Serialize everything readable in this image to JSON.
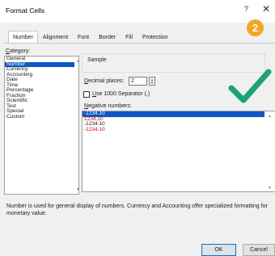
{
  "dialog": {
    "title": "Format Cells",
    "help_label": "?",
    "close_label": "✕",
    "badge": "2"
  },
  "tabs": [
    "Number",
    "Alignment",
    "Font",
    "Border",
    "Fill",
    "Protection"
  ],
  "category": {
    "label_underlined": "C",
    "label_rest": "ategory:",
    "items": [
      "General",
      "Number",
      "Currency",
      "Accounting",
      "Date",
      "Time",
      "Percentage",
      "Fraction",
      "Scientific",
      "Text",
      "Special",
      "Custom"
    ],
    "selected": "Number"
  },
  "sample": {
    "label": "Sample",
    "value": ""
  },
  "decimal": {
    "label_underlined": "D",
    "label_rest": "ecimal places:",
    "value": "2"
  },
  "separator": {
    "label_underlined": "U",
    "label_rest": "se 1000 Separator (,)",
    "checked": false
  },
  "negative": {
    "label_underlined": "N",
    "label_rest": "egative numbers:",
    "items": [
      {
        "text": "-1234.10",
        "color": "#ffffff",
        "selected": true
      },
      {
        "text": "1234.10",
        "color": "#e00000",
        "selected": false
      },
      {
        "text": "-1234.10",
        "color": "#1a1a1a",
        "selected": false
      },
      {
        "text": "-1234.10",
        "color": "#e00000",
        "selected": false
      }
    ]
  },
  "description": "Number is used for general display of numbers.  Currency and Accounting offer specialized formatting for monetary value.",
  "buttons": {
    "ok": "OK",
    "cancel": "Cancel"
  },
  "colors": {
    "accent": "#0b57c5",
    "checkmark": "#1aa672",
    "badge": "#f5a623",
    "negative_red": "#e00000"
  },
  "icons": {
    "help": "question-mark",
    "close": "x",
    "checkmark": "green-checkmark",
    "spin": "up-down-arrows"
  }
}
